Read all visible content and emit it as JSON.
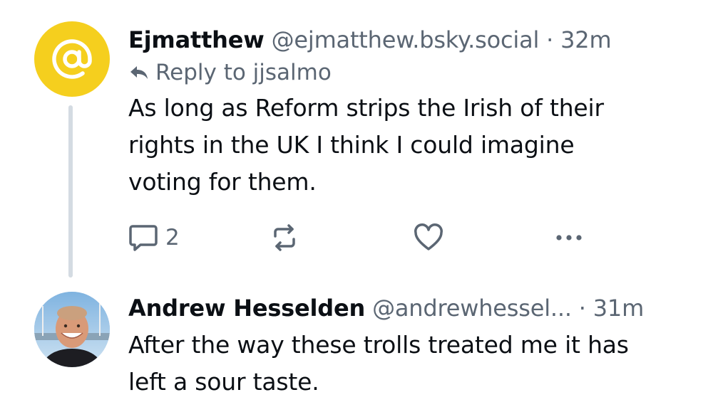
{
  "posts": [
    {
      "avatar_icon": "at-sign-icon",
      "avatar_color": "#f5cf1e",
      "display_name": "Ejmatthew",
      "handle": "@ejmatthew.bsky.social",
      "separator": "·",
      "time": "32m",
      "reply_to": "Reply to jjsalmo",
      "text_lines": [
        "As long as Reform strips the Irish of their",
        "rights in the UK I think I could imagine",
        "voting for them."
      ],
      "reply_count": "2"
    },
    {
      "display_name": "Andrew Hesselden",
      "handle": "@andrewhessel...",
      "separator": "·",
      "time": "31m",
      "text_lines": [
        "After the way these trolls treated me it has",
        "left a sour taste."
      ]
    }
  ],
  "colors": {
    "text": "#0b0f14",
    "muted": "#5b6673",
    "thread_line": "#d4dbe2"
  }
}
